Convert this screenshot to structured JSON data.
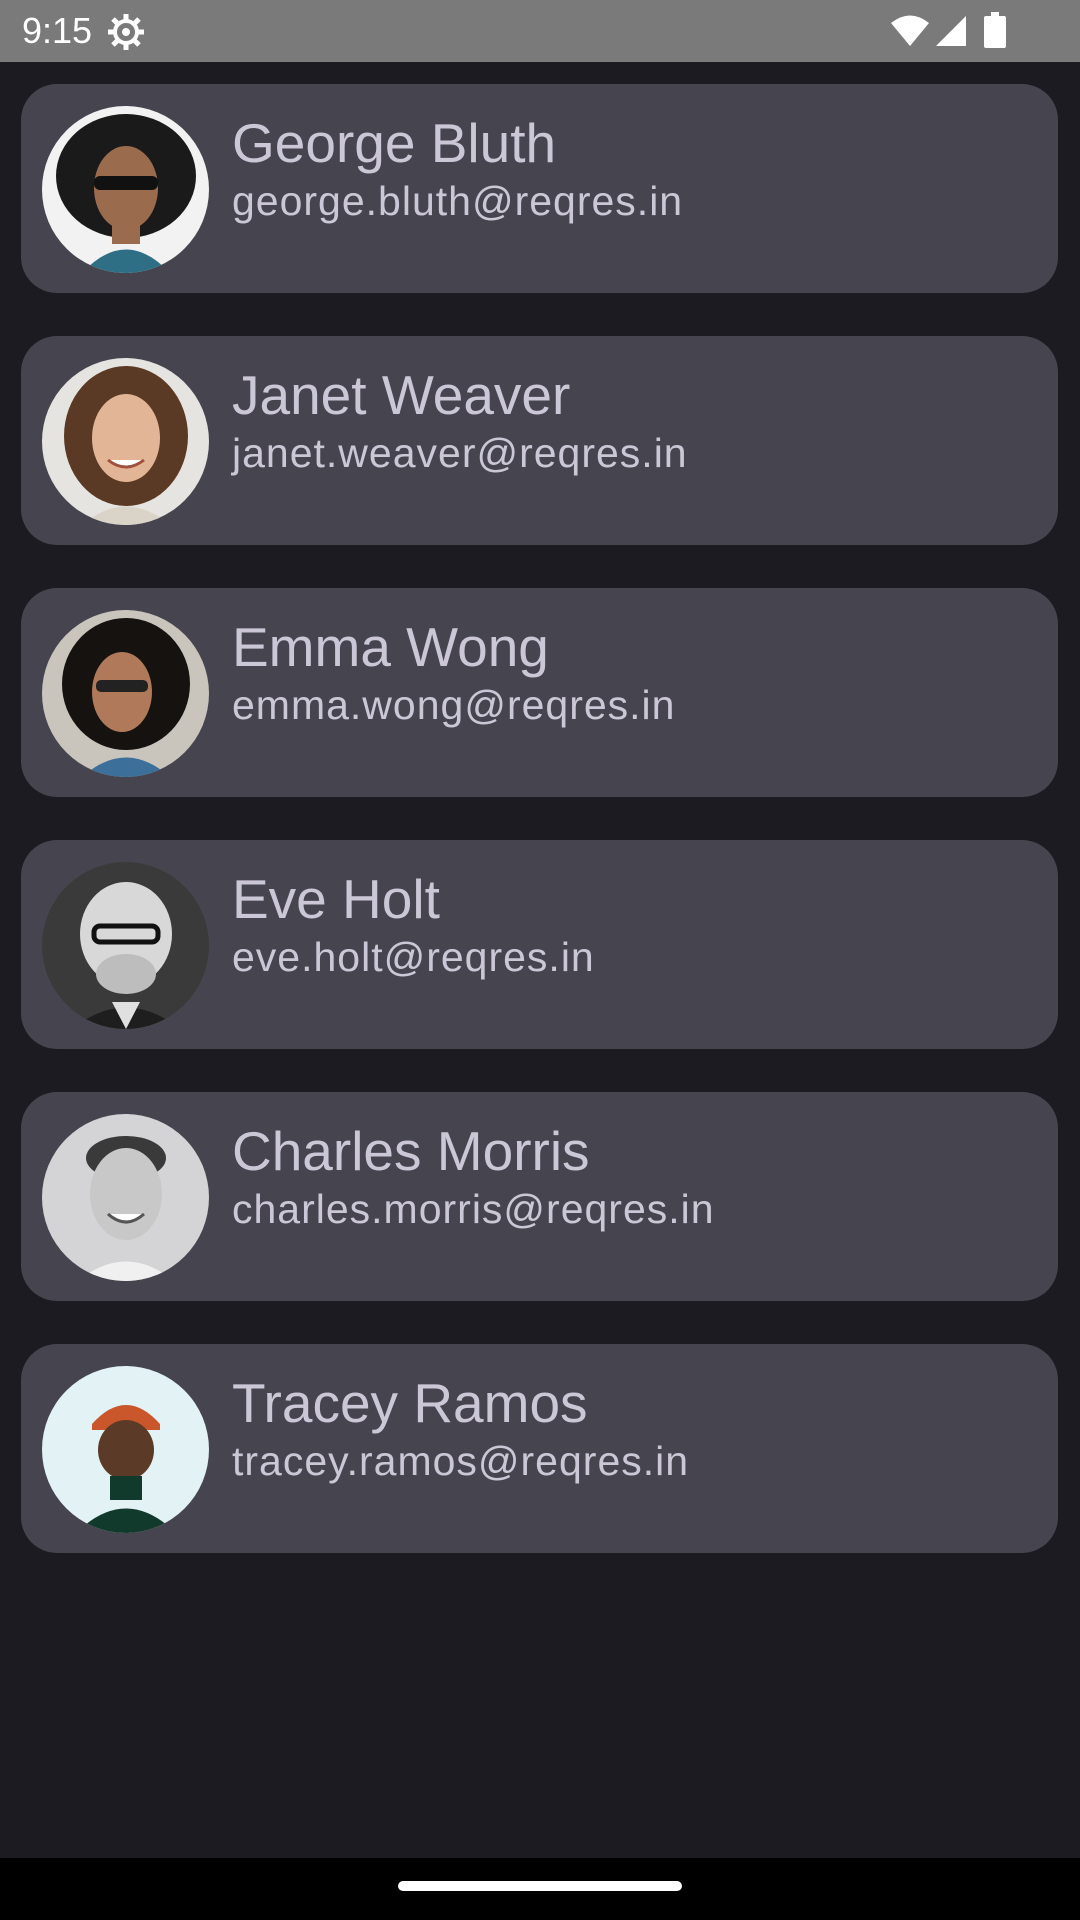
{
  "status_bar": {
    "time": "9:15",
    "icons": [
      "gear-icon",
      "wifi-icon",
      "signal-icon",
      "battery-icon"
    ],
    "background": "#7a7a7a"
  },
  "users": [
    {
      "name": "George Bluth",
      "email": "george.bluth@reqres.in",
      "avatar": "avatar-photo-george"
    },
    {
      "name": "Janet Weaver",
      "email": "janet.weaver@reqres.in",
      "avatar": "avatar-photo-janet"
    },
    {
      "name": "Emma Wong",
      "email": "emma.wong@reqres.in",
      "avatar": "avatar-photo-emma"
    },
    {
      "name": "Eve Holt",
      "email": "eve.holt@reqres.in",
      "avatar": "avatar-photo-eve"
    },
    {
      "name": "Charles Morris",
      "email": "charles.morris@reqres.in",
      "avatar": "avatar-photo-charles"
    },
    {
      "name": "Tracey Ramos",
      "email": "tracey.ramos@reqres.in",
      "avatar": "avatar-photo-tracey"
    }
  ],
  "colors": {
    "background": "#1c1b21",
    "card": "#46454f",
    "text": "#cbc7d6",
    "nav_bar": "#000000"
  }
}
